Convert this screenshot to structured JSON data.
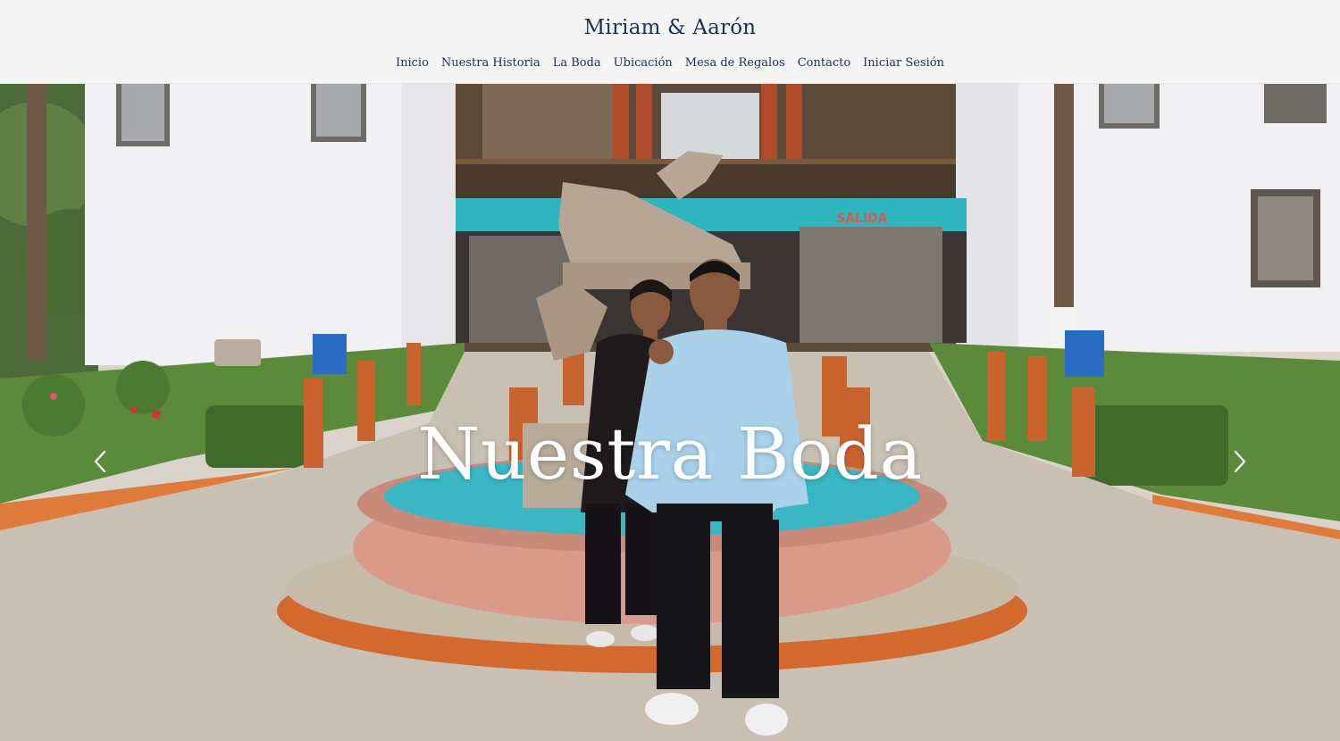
{
  "header": {
    "title": "Miriam & Aarón",
    "nav": [
      {
        "label": "Inicio"
      },
      {
        "label": "Nuestra Historia"
      },
      {
        "label": "La Boda"
      },
      {
        "label": "Ubicación"
      },
      {
        "label": "Mesa de Regalos"
      },
      {
        "label": "Contacto"
      },
      {
        "label": "Iniciar Sesión"
      }
    ]
  },
  "hero": {
    "title": "Nuestra Boda",
    "sign_text": "SALIDA",
    "prev_icon": "chevron-left-icon",
    "next_icon": "chevron-right-icon"
  },
  "colors": {
    "brand": "#1d2d5c",
    "header_bg": "#f5f5f5",
    "hero_text": "#ffffff"
  }
}
